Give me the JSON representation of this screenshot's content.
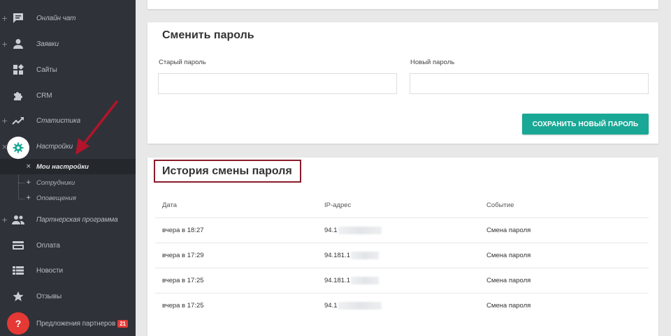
{
  "sidebar": {
    "items": [
      {
        "label": "Онлайн чат",
        "expander": "+",
        "icon": "chat-icon"
      },
      {
        "label": "Заявки",
        "expander": "+",
        "icon": "user-icon"
      },
      {
        "label": "Сайты",
        "expander": "",
        "icon": "widgets-icon"
      },
      {
        "label": "CRM",
        "expander": "",
        "icon": "puzzle-icon"
      },
      {
        "label": "Статистика",
        "expander": "+",
        "icon": "trending-up-icon"
      },
      {
        "label": "Настройки",
        "expander": "×",
        "icon": "gear-icon"
      },
      {
        "label": "Партнерская программа",
        "expander": "+",
        "icon": "group-icon"
      },
      {
        "label": "Оплата",
        "expander": "",
        "icon": "credit-card-icon"
      },
      {
        "label": "Новости",
        "expander": "",
        "icon": "list-icon"
      },
      {
        "label": "Отзывы",
        "expander": "",
        "icon": "star-icon"
      },
      {
        "label": "Предложения партнеров",
        "expander": "",
        "icon": "help-icon",
        "badge": "21"
      }
    ],
    "subitems": [
      {
        "label": "Мои настройки",
        "mark": "×"
      },
      {
        "label": "Сотрудники",
        "mark": "+"
      },
      {
        "label": "Оповещения",
        "mark": "+"
      }
    ],
    "help_glyph": "?"
  },
  "change_password": {
    "title": "Сменить пароль",
    "old_label": "Старый пароль",
    "old_value": "",
    "new_label": "Новый пароль",
    "new_value": "",
    "save_label": "СОХРАНИТЬ НОВЫЙ ПАРОЛЬ"
  },
  "history": {
    "title": "История смены пароля",
    "columns": [
      "Дата",
      "IP-адрес",
      "Событие"
    ],
    "rows": [
      {
        "date": "вчера в 18:27",
        "ip": "94.1",
        "event": "Смена пароля"
      },
      {
        "date": "вчера в 17:29",
        "ip": "94.181.1",
        "event": "Смена пароля"
      },
      {
        "date": "вчера в 17:25",
        "ip": "94.181.1",
        "event": "Смена пароля"
      },
      {
        "date": "вчера в 17:25",
        "ip": "94.1",
        "event": "Смена пароля"
      }
    ]
  },
  "colors": {
    "sidebar_bg": "#2f3239",
    "accent_teal": "#1aa896",
    "highlight_box": "#8b1a2b",
    "arrow": "#b3142b",
    "badge": "#e53935"
  }
}
